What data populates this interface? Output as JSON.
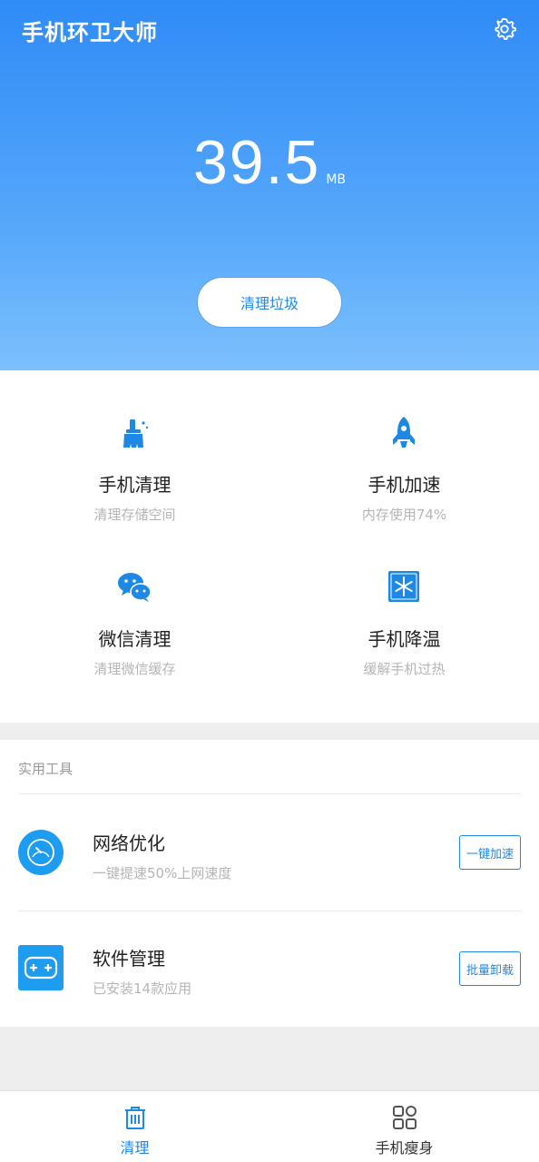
{
  "app": {
    "title": "手机环卫大师"
  },
  "hero": {
    "size_value": "39.5",
    "size_unit": "MB",
    "clean_button": "清理垃圾"
  },
  "features": [
    {
      "title": "手机清理",
      "subtitle": "清理存储空间",
      "icon": "broom-icon"
    },
    {
      "title": "手机加速",
      "subtitle": "内存使用74%",
      "icon": "rocket-icon"
    },
    {
      "title": "微信清理",
      "subtitle": "清理微信缓存",
      "icon": "wechat-icon"
    },
    {
      "title": "手机降温",
      "subtitle": "缓解手机过热",
      "icon": "snowflake-icon"
    }
  ],
  "tools": {
    "header": "实用工具",
    "items": [
      {
        "title": "网络优化",
        "subtitle": "一键提速50%上网速度",
        "button": "一键加速",
        "icon": "speedometer-icon"
      },
      {
        "title": "软件管理",
        "subtitle": "已安装14款应用",
        "button": "批量卸载",
        "icon": "gamepad-icon"
      }
    ]
  },
  "nav": {
    "items": [
      {
        "label": "清理",
        "icon": "trash-icon",
        "active": true
      },
      {
        "label": "手机瘦身",
        "icon": "grid-icon",
        "active": false
      }
    ]
  },
  "colors": {
    "accent": "#1e88e5",
    "hero_top": "#2f8bf6",
    "hero_bottom": "#7cc0fd",
    "muted": "#b5b5b5"
  }
}
